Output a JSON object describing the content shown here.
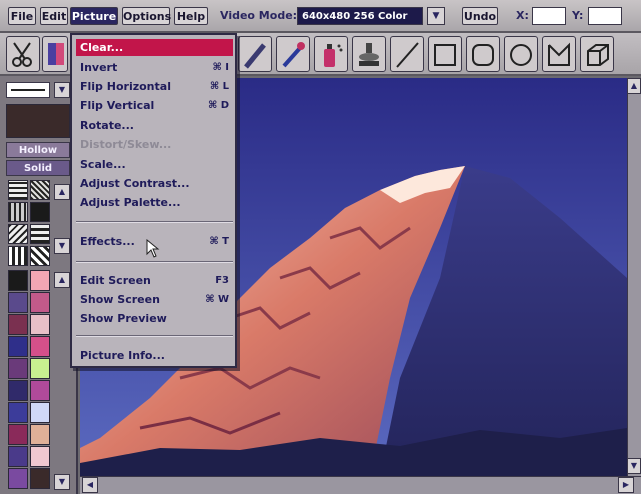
{
  "menubar": {
    "items": [
      "File",
      "Edit",
      "Picture",
      "Options",
      "Help"
    ],
    "video_mode_label": "Video Mode:",
    "video_mode_value": "640x480 256 Color",
    "undo_label": "Undo",
    "x_label": "X:",
    "y_label": "Y:"
  },
  "left_panel": {
    "hollow_label": "Hollow",
    "solid_label": "Solid",
    "swatch_colors": [
      "#1a1a1a",
      "#f2a6b4",
      "#5a4a8c",
      "#c25a8a",
      "#7a3050",
      "#e8c0c8",
      "#2f2f8a",
      "#d4508a",
      "#6a3a7a",
      "#c8f090",
      "#302a6a",
      "#b04a9a",
      "#3c3c9a",
      "#d0d8f8",
      "#8a2a5a",
      "#e0b098",
      "#4a3a8a",
      "#f0c8d0",
      "#7a4aa0",
      "#3a2a2a"
    ]
  },
  "picture_menu": {
    "items": [
      {
        "label": "Clear...",
        "shortcut": ""
      },
      {
        "label": "Invert",
        "shortcut": "⌘ I"
      },
      {
        "label": "Flip Horizontal",
        "shortcut": "⌘ L"
      },
      {
        "label": "Flip Vertical",
        "shortcut": "⌘ D"
      },
      {
        "label": "Rotate...",
        "shortcut": ""
      },
      {
        "label": "Distort/Skew...",
        "shortcut": ""
      },
      {
        "label": "Scale...",
        "shortcut": ""
      },
      {
        "label": "Adjust Contrast...",
        "shortcut": ""
      },
      {
        "label": "Adjust Palette...",
        "shortcut": ""
      },
      {
        "label": "Effects...",
        "shortcut": "⌘ T"
      },
      {
        "label": "Edit Screen",
        "shortcut": "F3"
      },
      {
        "label": "Show Screen",
        "shortcut": "⌘ W"
      },
      {
        "label": "Show Preview",
        "shortcut": ""
      },
      {
        "label": "Picture Info...",
        "shortcut": ""
      }
    ]
  },
  "colors": {
    "accent_highlight": "#c2154a",
    "menu_text": "#1f1b5a",
    "sky": "#2a2b86"
  },
  "tools": [
    "scissors-icon",
    "color-pick-icon",
    "brush-icon",
    "eyedropper-icon",
    "spraycan-icon",
    "stamp-icon",
    "line-icon",
    "rectangle-icon",
    "rounded-rect-icon",
    "ellipse-icon",
    "polygon-icon",
    "cube-icon"
  ]
}
